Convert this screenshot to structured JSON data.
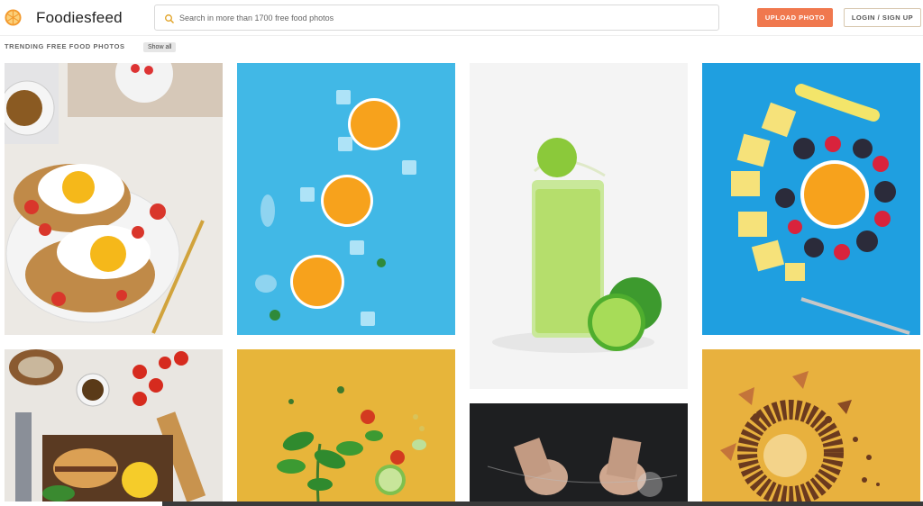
{
  "header": {
    "brand": "Foodiesfeed",
    "logo_icon": "orange-slice-logo-icon",
    "search": {
      "placeholder": "Search in more than 1700 free food photos",
      "value": ""
    },
    "upload_label": "UPLOAD PHOTO",
    "login_label": "LOGIN / SIGN UP"
  },
  "section": {
    "title": "TRENDING FREE FOOD PHOTOS",
    "show_all_label": "Show all"
  },
  "photos": [
    {
      "subject": "toast with fried eggs and tomatoes"
    },
    {
      "subject": "orange slices and ice cubes on blue"
    },
    {
      "subject": "lime juice glass with splash"
    },
    {
      "subject": "fruit circle with orange and berries on blue"
    },
    {
      "subject": "burger and fries on tray"
    },
    {
      "subject": "basil leaves and vegetables on yellow"
    },
    {
      "subject": "hands with flour on dark background"
    },
    {
      "subject": "coffee beans circle on yellow"
    }
  ],
  "colors": {
    "accent": "#f0784e",
    "sky_blue": "#41b8e6",
    "mustard": "#e7b53a"
  }
}
